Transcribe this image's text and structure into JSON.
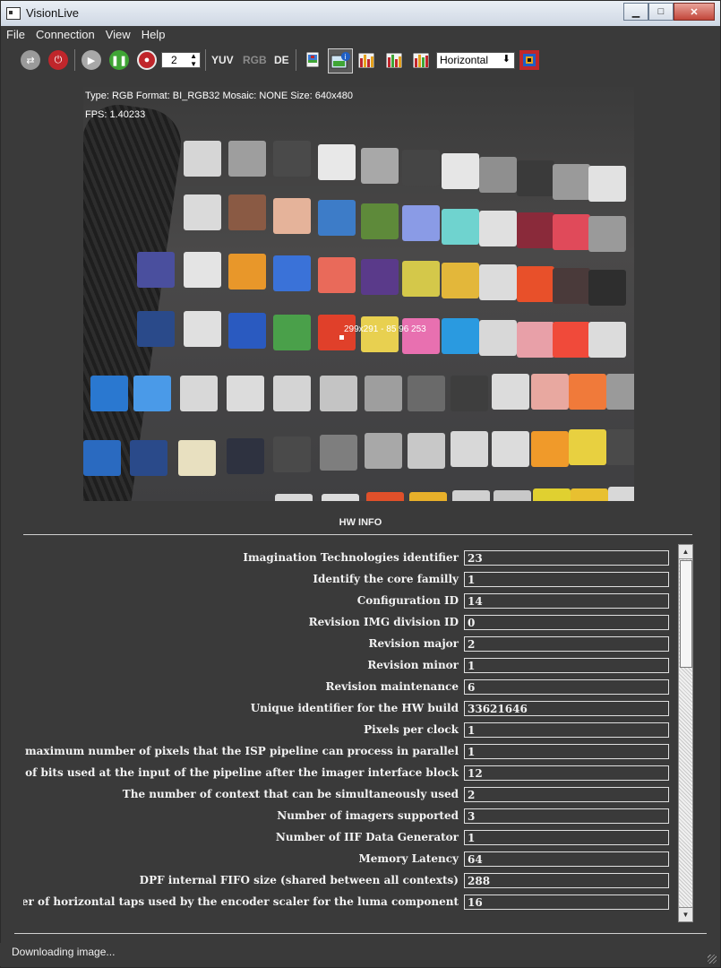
{
  "window": {
    "title": "VisionLive",
    "minimize": "▁",
    "maximize": "□",
    "close": "✕"
  },
  "menu": [
    "File",
    "Connection",
    "View",
    "Help"
  ],
  "toolbar": {
    "spin_value": "2",
    "yuv_label": "YUV",
    "rgb_label": "RGB",
    "de_label": "DE",
    "orientation_value": "Horizontal",
    "icons": [
      "refresh-icon",
      "plug-icon",
      "play-icon",
      "pause-icon",
      "record-icon",
      "image-stack-icon",
      "image-info-icon",
      "histogram-icon",
      "histogram-icon-2",
      "histogram-icon-3",
      "color-map-icon"
    ],
    "colors": {
      "plug": "#c0262b",
      "pause": "#3fa535",
      "record": "#c0262b",
      "bg": "#3a3a3a"
    }
  },
  "camera": {
    "info_line": "Type: RGB Format: BI_RGB32 Mosaic: NONE Size: 640x480",
    "fps_line": "FPS: 1.40233",
    "pixel_readout": "299x291 - 85 96 253"
  },
  "hw_info": {
    "title": "HW INFO",
    "rows": [
      {
        "label": "Imagination Technologies identifier",
        "value": "23"
      },
      {
        "label": "Identify the core familly",
        "value": "1"
      },
      {
        "label": "Configuration ID",
        "value": "14"
      },
      {
        "label": "Revision IMG division ID",
        "value": "0"
      },
      {
        "label": "Revision major",
        "value": "2"
      },
      {
        "label": "Revision minor",
        "value": "1"
      },
      {
        "label": "Revision maintenance",
        "value": "6"
      },
      {
        "label": "Unique identifier for the HW build",
        "value": "33621646"
      },
      {
        "label": "Pixels per clock",
        "value": "1"
      },
      {
        "label": "The maximum number of pixels that the ISP pipeline can process in parallel",
        "value": "1"
      },
      {
        "label": "Number of bits used at the input of the pipeline after the imager interface block",
        "value": "12"
      },
      {
        "label": "The number of context that can be simultaneously used",
        "value": "2"
      },
      {
        "label": "Number of imagers supported",
        "value": "3"
      },
      {
        "label": "Number of IIF Data Generator",
        "value": "1"
      },
      {
        "label": "Memory Latency",
        "value": "64"
      },
      {
        "label": "DPF internal FIFO size (shared between all contexts)",
        "value": "288"
      },
      {
        "label": "The number of horizontal taps used by the encoder scaler for the luma component",
        "value": "16"
      }
    ]
  },
  "status": {
    "text": "Downloading image..."
  }
}
